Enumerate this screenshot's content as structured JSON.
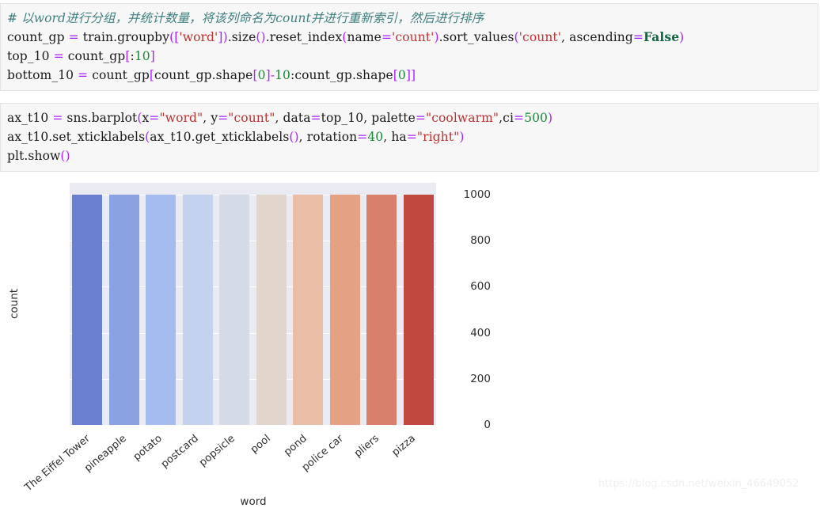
{
  "cells": [
    {
      "name": "code-cell-1",
      "lines": [
        [
          {
            "t": "comment",
            "v": "# 以word进行分组，并统计数量，将该列命名为count并进行重新索引，然后进行排序"
          }
        ],
        [
          {
            "t": "plain",
            "v": "count_gp "
          },
          {
            "t": "op",
            "v": "="
          },
          {
            "t": "plain",
            "v": " train."
          },
          {
            "t": "plain",
            "v": "groupby"
          },
          {
            "t": "punct",
            "v": "(["
          },
          {
            "t": "str",
            "v": "'word'"
          },
          {
            "t": "punct",
            "v": "])"
          },
          {
            "t": "plain",
            "v": ".size"
          },
          {
            "t": "punct",
            "v": "()"
          },
          {
            "t": "plain",
            "v": ".reset_index"
          },
          {
            "t": "punct",
            "v": "("
          },
          {
            "t": "plain",
            "v": "name"
          },
          {
            "t": "op",
            "v": "="
          },
          {
            "t": "str",
            "v": "'count'"
          },
          {
            "t": "punct",
            "v": ")"
          },
          {
            "t": "plain",
            "v": ".sort_values"
          },
          {
            "t": "punct",
            "v": "("
          },
          {
            "t": "str",
            "v": "'count'"
          },
          {
            "t": "plain",
            "v": ", ascending"
          },
          {
            "t": "op",
            "v": "="
          },
          {
            "t": "kw",
            "v": "False"
          },
          {
            "t": "punct",
            "v": ")"
          }
        ],
        [
          {
            "t": "plain",
            "v": "top_10 "
          },
          {
            "t": "op",
            "v": "="
          },
          {
            "t": "plain",
            "v": " count_gp"
          },
          {
            "t": "punct",
            "v": "["
          },
          {
            "t": "plain",
            "v": ":"
          },
          {
            "t": "num",
            "v": "10"
          },
          {
            "t": "punct",
            "v": "]"
          }
        ],
        [
          {
            "t": "plain",
            "v": "bottom_10 "
          },
          {
            "t": "op",
            "v": "="
          },
          {
            "t": "plain",
            "v": " count_gp"
          },
          {
            "t": "punct",
            "v": "["
          },
          {
            "t": "plain",
            "v": "count_gp.shape"
          },
          {
            "t": "punct",
            "v": "["
          },
          {
            "t": "num",
            "v": "0"
          },
          {
            "t": "punct",
            "v": "]"
          },
          {
            "t": "op",
            "v": "-"
          },
          {
            "t": "num",
            "v": "10"
          },
          {
            "t": "plain",
            "v": ":count_gp.shape"
          },
          {
            "t": "punct",
            "v": "["
          },
          {
            "t": "num",
            "v": "0"
          },
          {
            "t": "punct",
            "v": "]]"
          }
        ]
      ]
    },
    {
      "name": "code-cell-2",
      "lines": [
        [
          {
            "t": "plain",
            "v": "ax_t10 "
          },
          {
            "t": "op",
            "v": "="
          },
          {
            "t": "plain",
            "v": " sns.barplot"
          },
          {
            "t": "punct",
            "v": "("
          },
          {
            "t": "plain",
            "v": "x"
          },
          {
            "t": "op",
            "v": "="
          },
          {
            "t": "str",
            "v": "\"word\""
          },
          {
            "t": "plain",
            "v": ", y"
          },
          {
            "t": "op",
            "v": "="
          },
          {
            "t": "str",
            "v": "\"count\""
          },
          {
            "t": "plain",
            "v": ", data"
          },
          {
            "t": "op",
            "v": "="
          },
          {
            "t": "plain",
            "v": "top_10, palette"
          },
          {
            "t": "op",
            "v": "="
          },
          {
            "t": "str",
            "v": "\"coolwarm\""
          },
          {
            "t": "plain",
            "v": ",ci"
          },
          {
            "t": "op",
            "v": "="
          },
          {
            "t": "num",
            "v": "500"
          },
          {
            "t": "punct",
            "v": ")"
          }
        ],
        [
          {
            "t": "plain",
            "v": "ax_t10.set_xticklabels"
          },
          {
            "t": "punct",
            "v": "("
          },
          {
            "t": "plain",
            "v": "ax_t10.get_xticklabels"
          },
          {
            "t": "punct",
            "v": "()"
          },
          {
            "t": "plain",
            "v": ", rotation"
          },
          {
            "t": "op",
            "v": "="
          },
          {
            "t": "num",
            "v": "40"
          },
          {
            "t": "plain",
            "v": ", ha"
          },
          {
            "t": "op",
            "v": "="
          },
          {
            "t": "str",
            "v": "\"right\""
          },
          {
            "t": "punct",
            "v": ")"
          }
        ],
        [
          {
            "t": "plain",
            "v": "plt.show"
          },
          {
            "t": "punct",
            "v": "()"
          }
        ]
      ]
    }
  ],
  "chart_data": {
    "type": "bar",
    "title": "",
    "xlabel": "word",
    "ylabel": "count",
    "categories": [
      "The Eiffel Tower",
      "pineapple",
      "potato",
      "postcard",
      "popsicle",
      "pool",
      "pond",
      "police car",
      "pliers",
      "pizza"
    ],
    "values": [
      1000,
      1000,
      1000,
      1000,
      1000,
      1000,
      1000,
      1000,
      1000,
      1000
    ],
    "ylim": [
      0,
      1000
    ],
    "yticks": [
      0,
      200,
      400,
      600,
      800,
      1000
    ],
    "ytick_labels": [
      "0",
      "200",
      "400",
      "600",
      "800",
      "1000"
    ],
    "grid": true,
    "legend": "none",
    "palette_name": "coolwarm",
    "bar_colors": [
      "#6b7fd0",
      "#89a3e2",
      "#a5bcf0",
      "#c3d3ef",
      "#d4dae6",
      "#e2d5cb",
      "#eabda6",
      "#e4a183",
      "#d9806d",
      "#c0483f"
    ],
    "xtick_rotation": 40,
    "plot_background": "#eaeaf2",
    "gridline_color": "#ffffff"
  },
  "watermark": {
    "text": "https://blog.csdn.net/weixin_46649052"
  }
}
